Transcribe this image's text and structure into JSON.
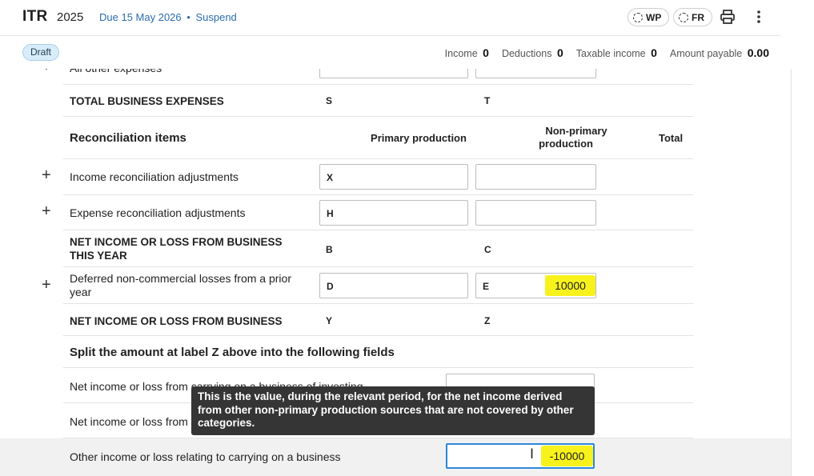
{
  "header": {
    "title": "ITR",
    "year": "2025",
    "due_prefix": "Due",
    "due_date": "15 May 2026",
    "separator": "•",
    "suspend_link": "Suspend",
    "wp_label": "WP",
    "fr_label": "FR"
  },
  "subbar": {
    "status_badge": "Draft",
    "stats": [
      {
        "label": "Income",
        "value": "0"
      },
      {
        "label": "Deductions",
        "value": "0"
      },
      {
        "label": "Taxable income",
        "value": "0"
      },
      {
        "label": "Amount payable",
        "value": "0.00"
      }
    ]
  },
  "form": {
    "partial_row_label": "All other expenses",
    "total_business_expenses": {
      "label": "TOTAL BUSINESS EXPENSES",
      "code_a": "S",
      "code_b": "T"
    },
    "reconciliation": {
      "heading": "Reconciliation items",
      "col_primary": "Primary production",
      "col_nonprimary_line1": "Non-primary",
      "col_nonprimary_line2": "production",
      "col_total": "Total"
    },
    "income_recon": {
      "label": "Income reconciliation adjustments",
      "code": "X"
    },
    "expense_recon": {
      "label": "Expense reconciliation adjustments",
      "code": "H"
    },
    "net_this_year": {
      "label_line1": "NET INCOME OR LOSS FROM BUSINESS",
      "label_line2": "THIS YEAR",
      "code_a": "B",
      "code_b": "C"
    },
    "deferred": {
      "label_line1": "Deferred non-commercial losses from a prior",
      "label_line2": "year",
      "code_a": "D",
      "code_b": "E",
      "value_b": "10000"
    },
    "net_business": {
      "label": "NET INCOME OR LOSS FROM BUSINESS",
      "code_a": "Y",
      "code_b": "Z"
    },
    "split_heading": "Split the amount at label Z above into the following fields",
    "split_row_1": "Net income or loss from carrying on a business of investing",
    "split_row_2": "Net income or loss from",
    "split_row_3": {
      "label": "Other income or loss relating to carrying on a business",
      "value": "-10000"
    }
  },
  "tooltip": {
    "text": "This is the value, during the relevant period, for the net income derived from other non-primary production sources that are not covered by other categories."
  },
  "colors": {
    "accent_blue": "#2b6cb0",
    "highlight": "#f7f21c",
    "focus_border": "#2c88d9"
  }
}
